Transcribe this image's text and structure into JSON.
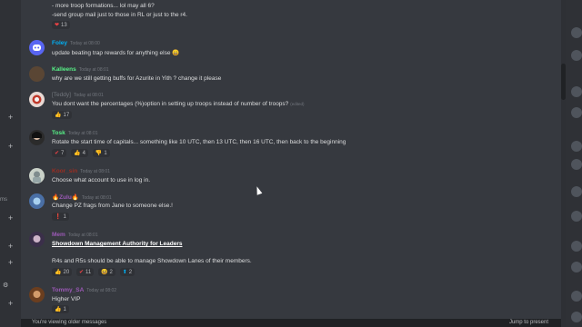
{
  "left_rail": {
    "labels": [
      "ms"
    ]
  },
  "messages": [
    {
      "id": "m0",
      "lines": [
        "- more troop formations... lol may all 6?",
        "-send group mail just to those in RL or just to the r4."
      ],
      "reactions": [
        {
          "emoji": "❤",
          "count": "13",
          "color": "#ed4245"
        }
      ]
    },
    {
      "id": "m1",
      "username": "Foley",
      "username_color": "#00b0f4",
      "timestamp": "Today at 08:00",
      "lines": [
        "update beating trap rewards for anything else 😄"
      ],
      "reactions": []
    },
    {
      "id": "m2",
      "username": "Kalleens",
      "username_color": "#57f287",
      "timestamp": "Today at 08:01",
      "lines": [
        "why are we still getting buffs for Azurite in Yith ? change it please"
      ],
      "reactions": []
    },
    {
      "id": "m3",
      "username": "[Teddy]",
      "username_color": "#72767d",
      "timestamp": "Today at 08:01",
      "lines": [
        "You dont want the percentages (%)option in setting up troops instead of number of troops?"
      ],
      "edited": "(edited)",
      "reactions": [
        {
          "emoji": "👍",
          "count": "17",
          "color": "#faa61a"
        }
      ]
    },
    {
      "id": "m4",
      "username": "Tosk",
      "username_color": "#57f287",
      "timestamp": "Today at 08:01",
      "lines": [
        "Rotate the start time of capitals... something like 10 UTC, then 13 UTC, then 16 UTC, then back to the beginning"
      ],
      "reactions": [
        {
          "emoji": "✔",
          "count": "7",
          "color": "#ed4245"
        },
        {
          "emoji": "👍",
          "count": "4",
          "color": "#faa61a"
        },
        {
          "emoji": "👎",
          "count": "1",
          "color": "#eb459e"
        }
      ]
    },
    {
      "id": "m5",
      "username": "Koor_sin",
      "username_color": "#992d22",
      "timestamp": "Today at 08:01",
      "lines": [
        "Choose what account to use in log in."
      ],
      "reactions": []
    },
    {
      "id": "m6",
      "username": "🔥Zulu🔥",
      "username_color": "#9b59b6",
      "timestamp": "Today at 08:01",
      "lines": [
        "Change PZ frags from Jane to someone else.!"
      ],
      "reactions": [
        {
          "emoji": "❗",
          "count": "1",
          "color": "#ed4245"
        }
      ]
    },
    {
      "id": "m7",
      "username": "Mem",
      "username_color": "#9b59b6",
      "timestamp": "Today at 08:01",
      "bold_line": "Showdown Management Authority for Leaders",
      "lines": [
        "R4s and R5s should be able to manage Showdown Lanes of their members."
      ],
      "reactions": [
        {
          "emoji": "👍",
          "count": "20",
          "color": "#faa61a"
        },
        {
          "emoji": "✔",
          "count": "11",
          "color": "#ed4245"
        },
        {
          "emoji": "😆",
          "count": "2",
          "color": "#faa61a"
        },
        {
          "emoji": "⬆",
          "count": "2",
          "color": "#00b0f4"
        }
      ]
    },
    {
      "id": "m8",
      "username": "Tommy_SA",
      "username_color": "#9b59b6",
      "timestamp": "Today at 08:02",
      "lines": [
        "Higher VIP"
      ],
      "reactions": [
        {
          "emoji": "👍",
          "count": "1",
          "color": "#faa61a"
        }
      ]
    }
  ],
  "bottom_bar": {
    "left": "You're viewing older messages",
    "right": "Jump to present"
  }
}
